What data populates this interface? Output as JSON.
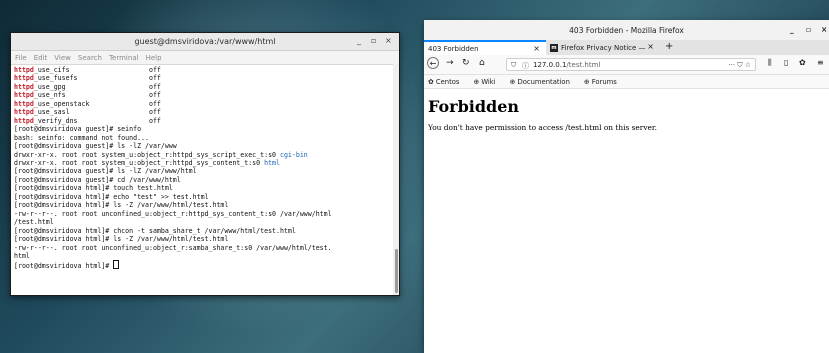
{
  "terminal": {
    "title": "guest@dmsviridova:/var/www/html",
    "window_controls": [
      "_",
      "▫",
      "×"
    ],
    "menu": [
      "File",
      "Edit",
      "View",
      "Search",
      "Terminal",
      "Help"
    ],
    "lines": [
      [
        {
          "t": "httpd",
          "c": "red"
        },
        {
          "t": "_use_cifs                    off"
        }
      ],
      [
        {
          "t": "httpd",
          "c": "red"
        },
        {
          "t": "_use_fusefs                  off"
        }
      ],
      [
        {
          "t": "httpd",
          "c": "red"
        },
        {
          "t": "_use_gpg                     off"
        }
      ],
      [
        {
          "t": "httpd",
          "c": "red"
        },
        {
          "t": "_use_nfs                     off"
        }
      ],
      [
        {
          "t": "httpd",
          "c": "red"
        },
        {
          "t": "_use_openstack               off"
        }
      ],
      [
        {
          "t": "httpd",
          "c": "red"
        },
        {
          "t": "_use_sasl                    off"
        }
      ],
      [
        {
          "t": "httpd",
          "c": "red"
        },
        {
          "t": "_verify_dns                  off"
        }
      ],
      [
        {
          "t": "[root@dmsviridova guest]# seinfo"
        }
      ],
      [
        {
          "t": "bash: seinfo: command not found..."
        }
      ],
      [
        {
          "t": "[root@dmsviridova guest]# ls -lZ /var/www"
        }
      ],
      [
        {
          "t": "drwxr-xr-x. root root system_u:object_r:httpd_sys_script_exec_t:s0 "
        },
        {
          "t": "cgi-bin",
          "c": "blue"
        }
      ],
      [
        {
          "t": "drwxr-xr-x. root root system_u:object_r:httpd_sys_content_t:s0 "
        },
        {
          "t": "html",
          "c": "blue"
        }
      ],
      [
        {
          "t": "[root@dmsviridova guest]# ls -lZ /var/www/html"
        }
      ],
      [
        {
          "t": "[root@dmsviridova guest]# cd /var/www/html"
        }
      ],
      [
        {
          "t": "[root@dmsviridova html]# touch test.html"
        }
      ],
      [
        {
          "t": "[root@dmsviridova html]# echo \"test\" >> test.html"
        }
      ],
      [
        {
          "t": "[root@dmsviridova html]# ls -Z /var/www/html/test.html"
        }
      ],
      [
        {
          "t": "-rw-r--r--. root root unconfined_u:object_r:httpd_sys_content_t:s0 /var/www/html"
        }
      ],
      [
        {
          "t": "/test.html"
        }
      ],
      [
        {
          "t": "[root@dmsviridova html]# chcon -t samba_share_t /var/www/html/test.html"
        }
      ],
      [
        {
          "t": "[root@dmsviridova html]# ls -Z /var/www/html/test.html"
        }
      ],
      [
        {
          "t": "-rw-r--r--. root root unconfined_u:object_r:samba_share_t:s0 /var/www/html/test."
        }
      ],
      [
        {
          "t": "html"
        }
      ],
      [
        {
          "t": "[root@dmsviridova html]# "
        },
        {
          "t": "",
          "c": "cursor"
        }
      ]
    ]
  },
  "firefox": {
    "title": "403 Forbidden - Mozilla Firefox",
    "window_controls": [
      "_",
      "▫",
      "×"
    ],
    "tabs": [
      {
        "label": "403 Forbidden",
        "active": true
      },
      {
        "label": "Firefox Privacy Notice —",
        "active": false
      }
    ],
    "new_tab": "+",
    "url_host": "127.0.0.1",
    "url_path": "/test.html",
    "url_actions": "··· ⛉ ☆",
    "bookmarks": [
      "Centos",
      "Wiki",
      "Documentation",
      "Forums"
    ],
    "page": {
      "heading": "Forbidden",
      "message": "You don't have permission to access /test.html on this server."
    }
  }
}
